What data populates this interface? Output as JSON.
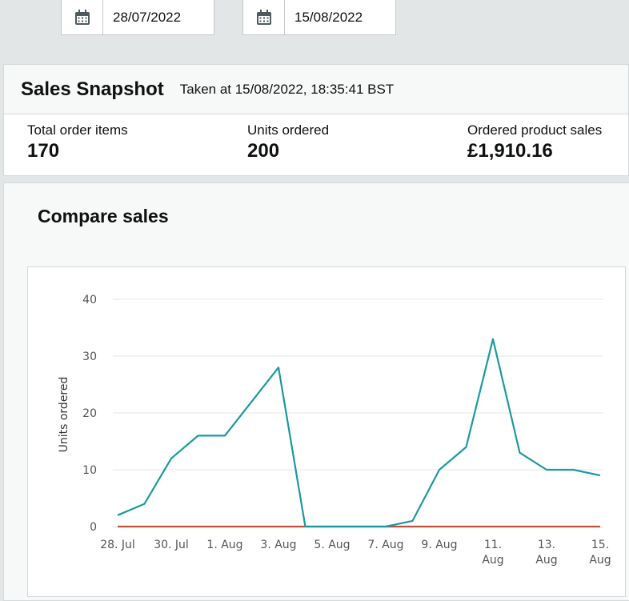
{
  "date_range": {
    "start": "28/07/2022",
    "end": "15/08/2022"
  },
  "snapshot": {
    "title": "Sales Snapshot",
    "taken_at": "Taken at 15/08/2022, 18:35:41 BST",
    "metrics": [
      {
        "label": "Total order items",
        "value": "170"
      },
      {
        "label": "Units ordered",
        "value": "200"
      },
      {
        "label": "Ordered product sales",
        "value": "£1,910.16"
      }
    ]
  },
  "compare": {
    "title": "Compare sales"
  },
  "colors": {
    "series_primary": "#1a9aa0",
    "series_secondary": "#c0503d",
    "grid": "#e6e6e6"
  },
  "chart_data": {
    "type": "line",
    "ylabel": "Units ordered",
    "ylim": [
      0,
      40
    ],
    "yticks": [
      0,
      10,
      20,
      30,
      40
    ],
    "x": [
      "28/07/2022",
      "29/07/2022",
      "30/07/2022",
      "31/07/2022",
      "01/08/2022",
      "02/08/2022",
      "03/08/2022",
      "04/08/2022",
      "05/08/2022",
      "06/08/2022",
      "07/08/2022",
      "08/08/2022",
      "09/08/2022",
      "10/08/2022",
      "11/08/2022",
      "12/08/2022",
      "13/08/2022",
      "14/08/2022",
      "15/08/2022"
    ],
    "xtick_labels": [
      {
        "label": [
          "28. Jul"
        ],
        "index": 0
      },
      {
        "label": [
          "30. Jul"
        ],
        "index": 2
      },
      {
        "label": [
          "1. Aug"
        ],
        "index": 4
      },
      {
        "label": [
          "3. Aug"
        ],
        "index": 6
      },
      {
        "label": [
          "5. Aug"
        ],
        "index": 8
      },
      {
        "label": [
          "7. Aug"
        ],
        "index": 10
      },
      {
        "label": [
          "9. Aug"
        ],
        "index": 12
      },
      {
        "label": [
          "11.",
          "Aug"
        ],
        "index": 14
      },
      {
        "label": [
          "13.",
          "Aug"
        ],
        "index": 16
      },
      {
        "label": [
          "15.",
          "Aug"
        ],
        "index": 18
      }
    ],
    "series": [
      {
        "values": [
          2,
          4,
          12,
          16,
          16,
          22,
          28,
          0,
          0,
          0,
          0,
          1,
          10,
          14,
          33,
          13,
          10,
          10,
          9
        ],
        "color": "#1a9aa0"
      },
      {
        "values": [
          0,
          0,
          0,
          0,
          0,
          0,
          0,
          0,
          0,
          0,
          0,
          0,
          0,
          0,
          0,
          0,
          0,
          0,
          0
        ],
        "color": "#c0503d"
      }
    ],
    "grid": true
  }
}
